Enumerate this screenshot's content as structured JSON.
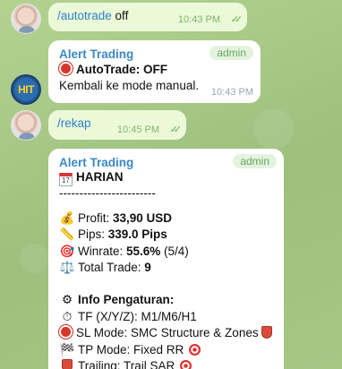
{
  "messages": [
    {
      "command": "/autotrade",
      "suffix": " off",
      "time": "10:43 PM"
    },
    {
      "sender": "Alert Trading",
      "tag": "admin",
      "title": "AutoTrade: OFF",
      "body": "Kembali ke mode manual.",
      "time": "10:43 PM",
      "avatar_text": "HIT"
    },
    {
      "command": "/rekap",
      "time": "10:45 PM"
    },
    {
      "sender": "Alert Trading",
      "tag": "admin",
      "heading": "HARIAN",
      "calendar_day": "17",
      "separator": "------------------------",
      "stats": [
        {
          "icon": "money-bag-icon",
          "glyph": "💰",
          "label": "Profit: ",
          "value": "33,90 USD"
        },
        {
          "icon": "ruler-icon",
          "glyph": "📏",
          "label": "Pips: ",
          "value": "339.0 Pips"
        },
        {
          "icon": "target-icon",
          "glyph": "🎯",
          "label": "Winrate: ",
          "value": "55.6%",
          "extra": " (5/4)"
        },
        {
          "icon": "scales-icon",
          "glyph": "⚖️",
          "label": "Total Trade: ",
          "value": "9"
        }
      ],
      "settings_title": "Info Pengaturan:",
      "settings": [
        {
          "icon": "stopwatch-icon",
          "glyph": "⏱",
          "text": "TF (X/Y/Z): M1/M6/H1"
        },
        {
          "icon": "stop-sign-icon",
          "text": "SL Mode: SMC Structure & Zones"
        },
        {
          "icon": "checkered-flag-icon",
          "glyph": "🏁",
          "text": "TP Mode: Fixed RR"
        },
        {
          "icon": "shield-icon",
          "text": "Trailing: Trail SAR"
        }
      ]
    }
  ]
}
